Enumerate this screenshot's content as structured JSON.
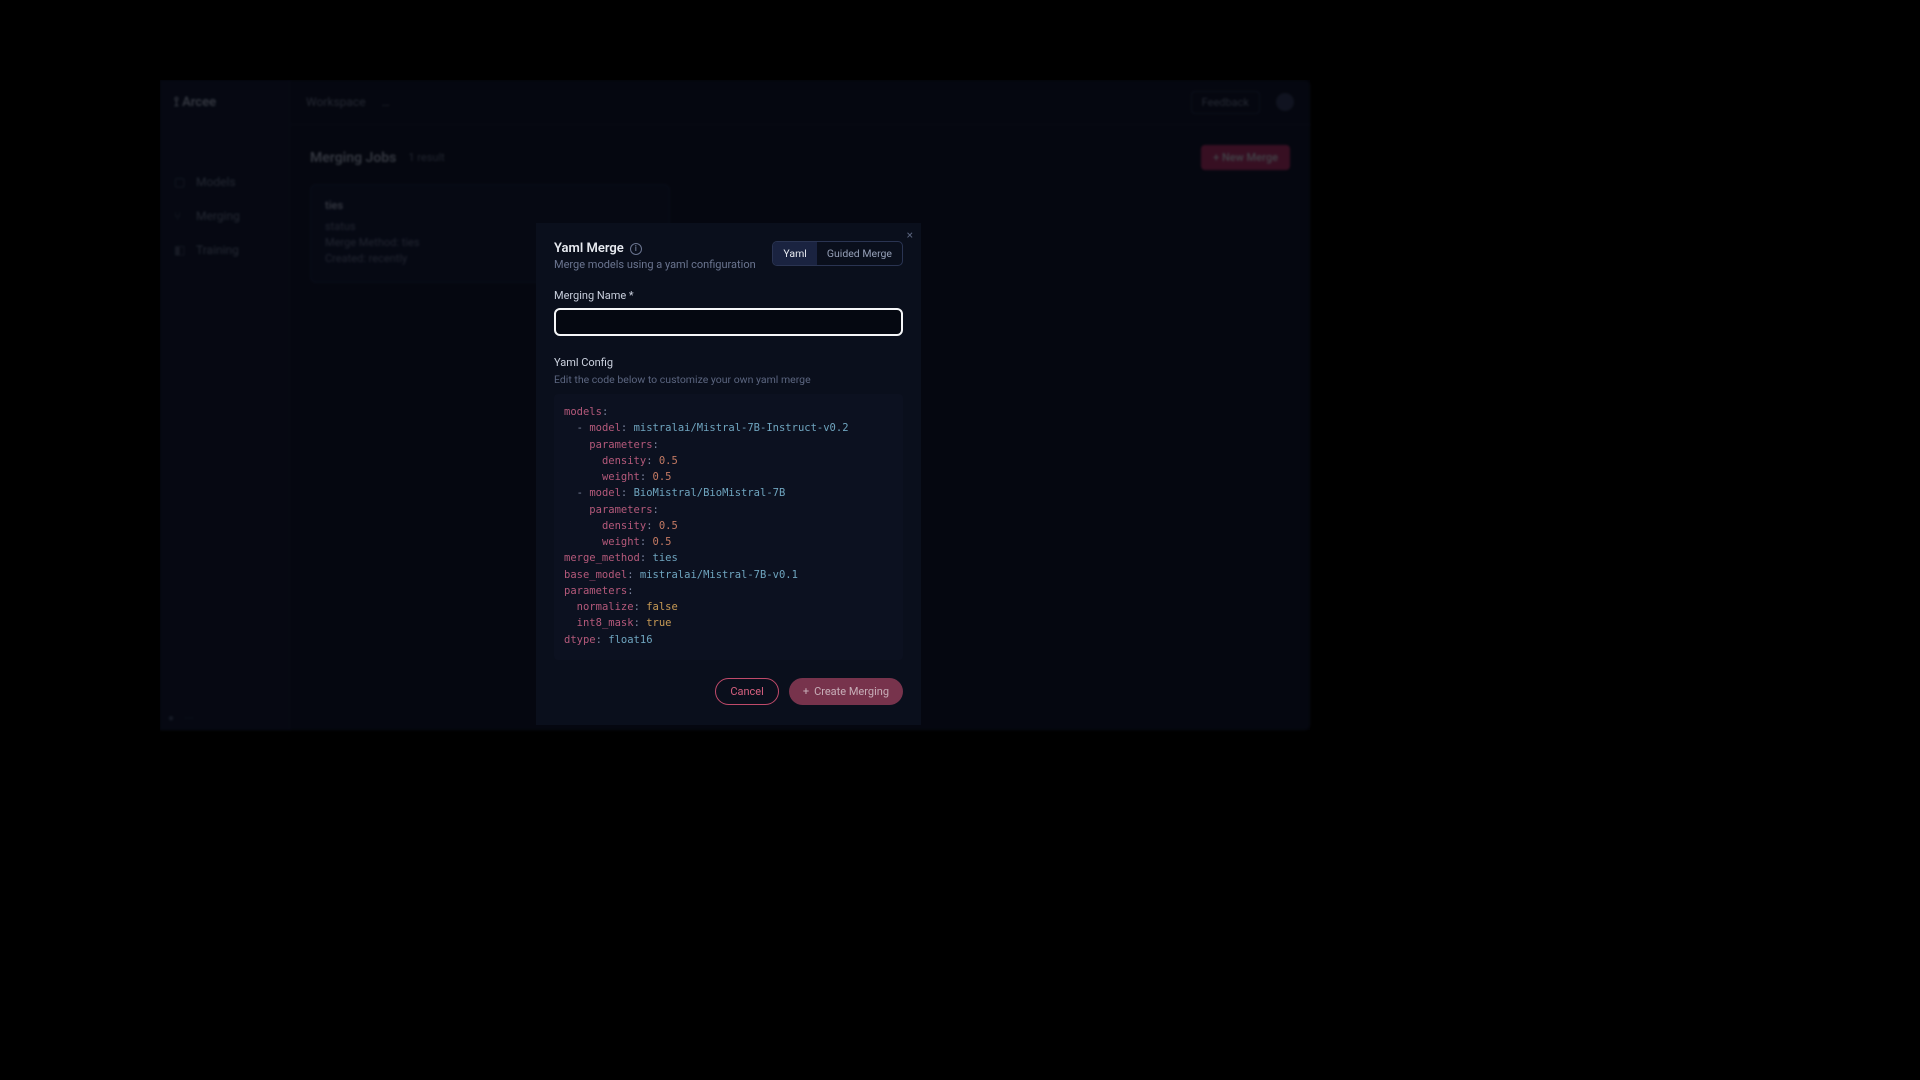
{
  "app": {
    "logo": "⟟ Arcee",
    "topbar": {
      "workspace": "Workspace",
      "crumb": "…",
      "right_btn": "Feedback"
    },
    "sidebar": {
      "items": [
        {
          "label": "Models"
        },
        {
          "label": "Merging"
        },
        {
          "label": "Training"
        }
      ]
    },
    "content": {
      "title": "Merging Jobs",
      "count": "1 result",
      "new_btn": "+ New Merge",
      "card": {
        "title": "ties",
        "line1": "status",
        "line2": "Merge Method: ties",
        "line3": "Created: recently"
      }
    },
    "status": {
      "left": "●",
      "right": "⋯"
    }
  },
  "modal": {
    "title": "Yaml Merge",
    "subtitle": "Merge models using a yaml configuration",
    "tabs": {
      "yaml": "Yaml",
      "guided": "Guided Merge"
    },
    "close": "×",
    "name_label": "Merging Name *",
    "name_value": "",
    "name_placeholder": "",
    "config_label": "Yaml Config",
    "config_help": "Edit the code below to customize your own yaml merge",
    "yaml": {
      "k_models": "models",
      "k_model": "model",
      "k_parameters": "parameters",
      "k_density": "density",
      "k_weight": "weight",
      "k_merge_method": "merge_method",
      "k_base_model": "base_model",
      "k_normalize": "normalize",
      "k_int8_mask": "int8_mask",
      "k_dtype": "dtype",
      "v_model1": "mistralai/Mistral-7B-Instruct-v0.2",
      "v_model2": "BioMistral/BioMistral-7B",
      "v_density1": "0.5",
      "v_weight1": "0.5",
      "v_density2": "0.5",
      "v_weight2": "0.5",
      "v_merge_method": "ties",
      "v_base_model": "mistralai/Mistral-7B-v0.1",
      "v_normalize": "false",
      "v_int8_mask": "true",
      "v_dtype": "float16"
    },
    "buttons": {
      "cancel": "Cancel",
      "create": "Create Merging",
      "plus": "+"
    }
  }
}
